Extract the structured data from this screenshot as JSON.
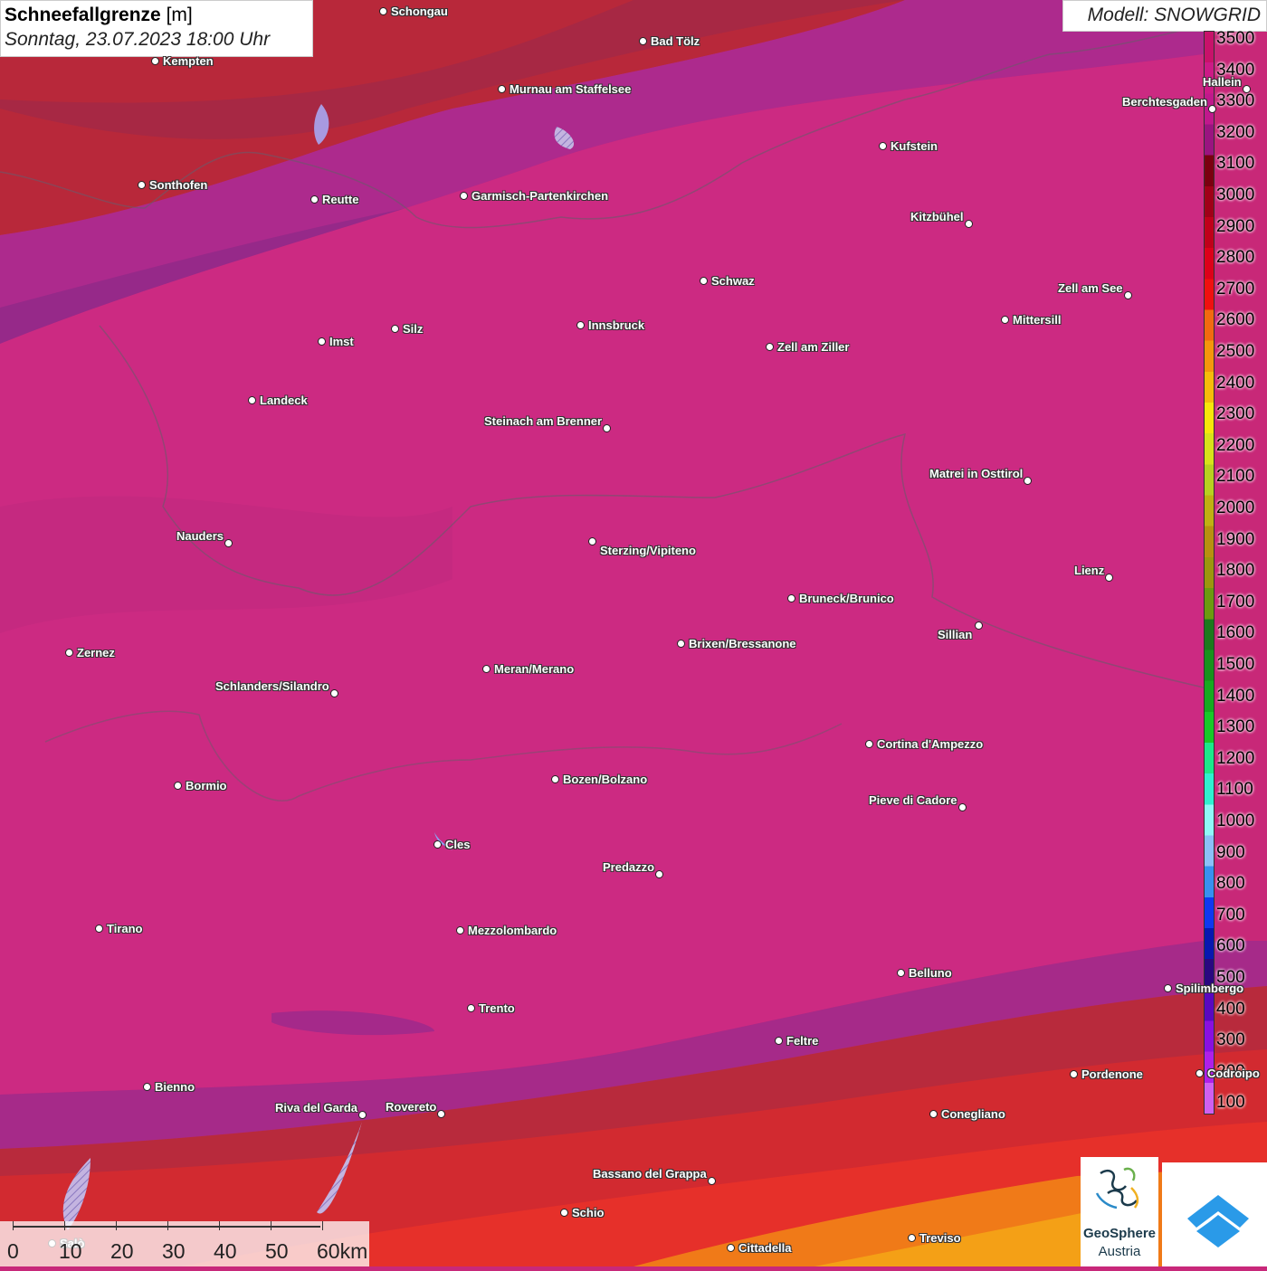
{
  "title": {
    "bold": "Schneefallgrenze",
    "unit": "[m]",
    "date": "Sonntag, 23.07.2023 18:00 Uhr"
  },
  "model": "Modell: SNOWGRID",
  "legend": {
    "labels": [
      "3500",
      "3400",
      "3300",
      "3200",
      "3100",
      "3000",
      "2900",
      "2800",
      "2700",
      "2600",
      "2500",
      "2400",
      "2300",
      "2200",
      "2100",
      "2000",
      "1900",
      "1800",
      "1700",
      "1600",
      "1500",
      "1400",
      "1300",
      "1200",
      "1100",
      "1000",
      "900",
      "800",
      "700",
      "600",
      "500",
      "400",
      "300",
      "200",
      "100"
    ],
    "colors": [
      "#c8126a",
      "#cc1a86",
      "#c0188c",
      "#9a1480",
      "#7a0010",
      "#a00018",
      "#c0001a",
      "#dd001a",
      "#f01010",
      "#f26a10",
      "#f5960c",
      "#f7bb0a",
      "#f8e60a",
      "#d8e21a",
      "#b8d020",
      "#c0b012",
      "#b89010",
      "#9c960e",
      "#6c9a10",
      "#1c7a1c",
      "#18921c",
      "#16aa20",
      "#18c828",
      "#1ce88a",
      "#30f0d0",
      "#90f8f8",
      "#8cc0f8",
      "#3890f0",
      "#1038f0",
      "#0818b0",
      "#2a0880",
      "#5a08c0",
      "#8a10e0",
      "#b020e8",
      "#d060f0"
    ]
  },
  "cities": [
    {
      "name": "Schongau"
    },
    {
      "name": "Bad Tölz"
    },
    {
      "name": "Kempten"
    },
    {
      "name": "Murnau am Staffelsee"
    },
    {
      "name": "Hallein"
    },
    {
      "name": "Berchtesgaden"
    },
    {
      "name": "Kufstein"
    },
    {
      "name": "Sonthofen"
    },
    {
      "name": "Reutte"
    },
    {
      "name": "Garmisch-Partenkirchen"
    },
    {
      "name": "Kitzbühel"
    },
    {
      "name": "Schwaz"
    },
    {
      "name": "Zell am See"
    },
    {
      "name": "Innsbruck"
    },
    {
      "name": "Mittersill"
    },
    {
      "name": "Silz"
    },
    {
      "name": "Imst"
    },
    {
      "name": "Zell am Ziller"
    },
    {
      "name": "Landeck"
    },
    {
      "name": "Steinach am Brenner"
    },
    {
      "name": "Matrei in Osttirol"
    },
    {
      "name": "Nauders"
    },
    {
      "name": "Sterzing/Vipiteno"
    },
    {
      "name": "Lienz"
    },
    {
      "name": "Bruneck/Brunico"
    },
    {
      "name": "Sillian"
    },
    {
      "name": "Brixen/Bressanone"
    },
    {
      "name": "Zernez"
    },
    {
      "name": "Meran/Merano"
    },
    {
      "name": "Schlanders/Silandro"
    },
    {
      "name": "Cortina d'Ampezzo"
    },
    {
      "name": "Bormio"
    },
    {
      "name": "Bozen/Bolzano"
    },
    {
      "name": "Pieve di Cadore"
    },
    {
      "name": "Cles"
    },
    {
      "name": "Predazzo"
    },
    {
      "name": "Tirano"
    },
    {
      "name": "Mezzolombardo"
    },
    {
      "name": "Belluno"
    },
    {
      "name": "Spilimbergo"
    },
    {
      "name": "Trento"
    },
    {
      "name": "Feltre"
    },
    {
      "name": "Pordenone"
    },
    {
      "name": "Codroipo"
    },
    {
      "name": "Bienno"
    },
    {
      "name": "Riva del Garda"
    },
    {
      "name": "Rovereto"
    },
    {
      "name": "Conegliano"
    },
    {
      "name": "Bassano del Grappa"
    },
    {
      "name": "Schio"
    },
    {
      "name": "Salò"
    },
    {
      "name": "Treviso"
    },
    {
      "name": "Cittadella"
    }
  ],
  "scale": {
    "labels": [
      "0",
      "10",
      "20",
      "30",
      "40",
      "50",
      "60km"
    ]
  },
  "logo": {
    "line1": "GeoSphere",
    "line2": "Austria"
  }
}
